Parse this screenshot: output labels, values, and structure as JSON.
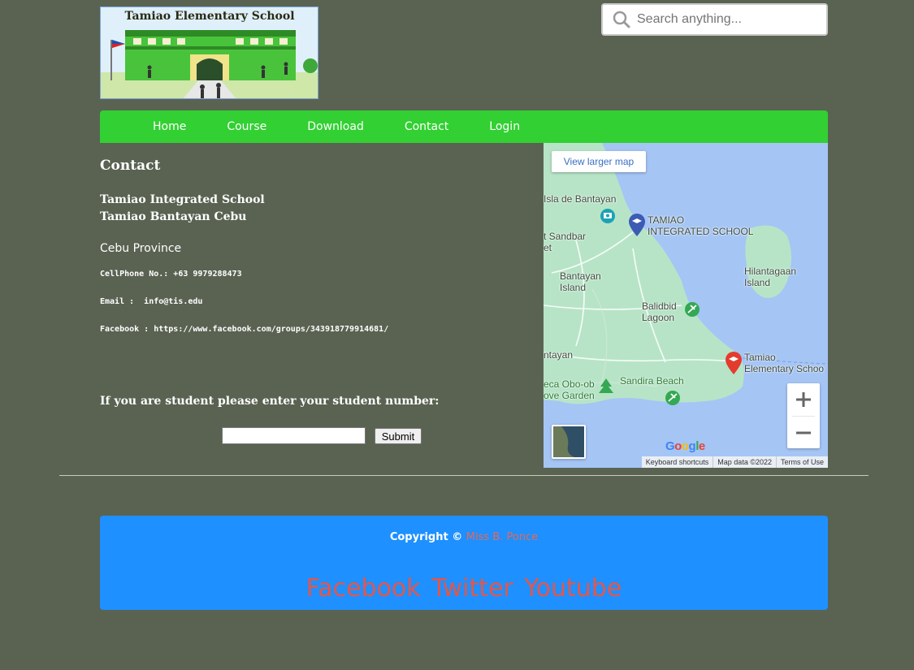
{
  "header": {
    "logo_text": "Tamiao Elementary School",
    "search_placeholder": "Search anything..."
  },
  "nav": {
    "items": [
      "Home",
      "Course",
      "Download",
      "Contact",
      "Login"
    ]
  },
  "contact": {
    "title": "Contact",
    "school_name": "Tamiao Integrated School",
    "school_address": "Tamiao Bantayan Cebu",
    "province": "Cebu Province",
    "phone_line": "CellPhone No.: +63 9979288473",
    "email_line": "Email :  info@tis.edu",
    "facebook_line": "Facebook : https://www.facebook.com/groups/343918779914681/",
    "student_prompt": "If you are student please enter your student number:",
    "submit_label": "Submit"
  },
  "map": {
    "view_larger": "View larger map",
    "labels": {
      "isla": "Isla de Bantayan",
      "tamiao_integrated": "TAMIAO\nINTEGRATED SCHOOL",
      "sandbar": "t Sandbar\net",
      "bantayan_island": "Bantayan\nIsland",
      "hilantagaan": "Hilantagaan\nIsland",
      "balidbid": "Balidbid\nLagoon",
      "ntayan": "ntayan",
      "tamiao_elementary": "Tamiao\nElementary Schoo",
      "sandira": "Sandira Beach",
      "obo_ob": "eca Obo-ob\nove Garden"
    },
    "google": "Google",
    "footer": [
      "Keyboard shortcuts",
      "Map data ©2022",
      "Terms of Use"
    ],
    "colors": {
      "water": "#a5c5f5",
      "land": "#b7e4c7",
      "pin_blue": "#3b5bb5",
      "pin_red": "#e33b2e",
      "pin_green": "#34a853"
    }
  },
  "footer": {
    "copyright_label": "Copyright ©",
    "author": "Miss B. Ponce",
    "social": [
      "Facebook",
      "Twitter",
      "Youtube"
    ]
  },
  "colors": {
    "page_bg": "#5a6352",
    "nav_bg": "#32d032",
    "footer_bg": "#1e90ff",
    "link_red": "#e2574c"
  }
}
